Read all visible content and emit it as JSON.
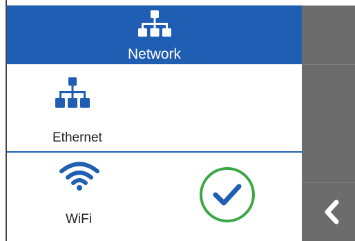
{
  "header": {
    "title": "Network",
    "icon": "network-icon"
  },
  "options": [
    {
      "id": "ethernet",
      "label": "Ethernet",
      "icon": "ethernet-icon",
      "selected": false
    },
    {
      "id": "wifi",
      "label": "WiFi",
      "icon": "wifi-icon",
      "selected": true
    }
  ],
  "sidebar": {
    "back_icon": "chevron-left-icon"
  },
  "colors": {
    "accent": "#1f5eb3",
    "selected_ring": "#39a845",
    "sidebar": "#6c6c6c",
    "icon": "#1f5eb3"
  }
}
